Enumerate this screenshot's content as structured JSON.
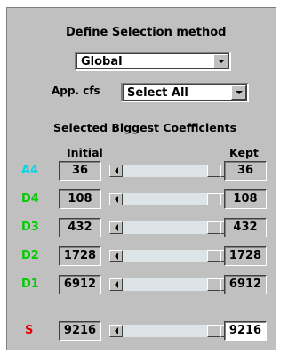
{
  "title": "Define Selection method",
  "method": {
    "value": "Global"
  },
  "app_cfs": {
    "label": "App. cfs",
    "value": "Select All"
  },
  "section_title": "Selected Biggest Coefficients",
  "headers": {
    "initial": "Initial",
    "kept": "Kept"
  },
  "rows": [
    {
      "level": "A4",
      "color": "#00d8e8",
      "initial": "36",
      "kept": "36"
    },
    {
      "level": "D4",
      "color": "#00cc00",
      "initial": "108",
      "kept": "108"
    },
    {
      "level": "D3",
      "color": "#00cc00",
      "initial": "432",
      "kept": "432"
    },
    {
      "level": "D2",
      "color": "#00cc00",
      "initial": "1728",
      "kept": "1728"
    },
    {
      "level": "D1",
      "color": "#00cc00",
      "initial": "6912",
      "kept": "6912"
    }
  ],
  "signal_row": {
    "level": "S",
    "color": "#e00000",
    "initial": "9216",
    "kept": "9216"
  },
  "icons": {
    "combo_arrow": "chevron-down-icon",
    "scroll_left": "arrow-left-icon",
    "scroll_right": "arrow-right-icon"
  }
}
